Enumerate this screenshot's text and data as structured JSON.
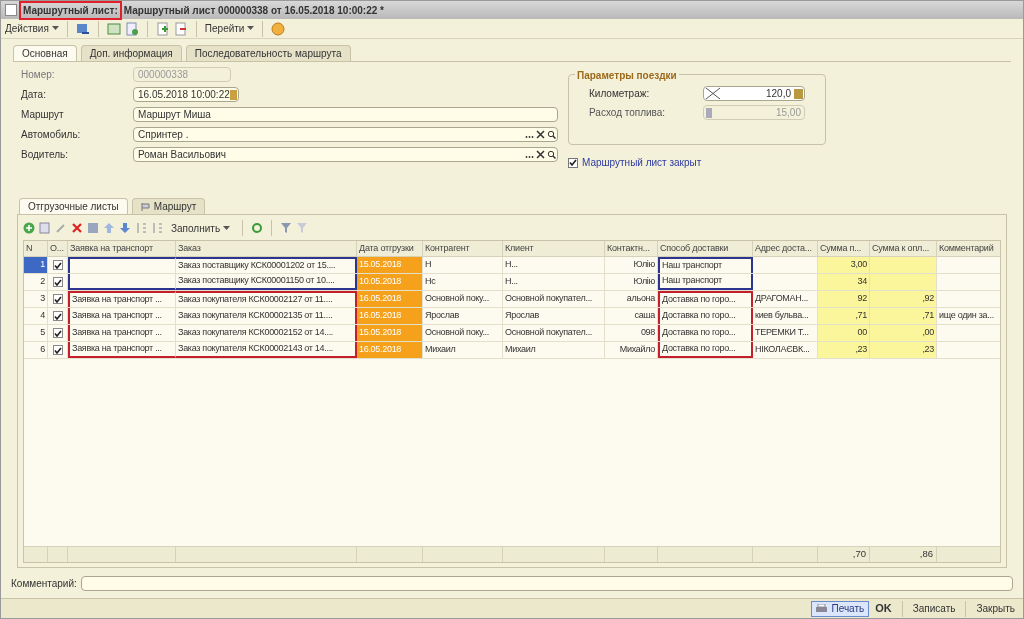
{
  "window": {
    "title_prefix": "Маршрутный лист:",
    "title": "Маршрутный лист 000000338 от 16.05.2018 10:00:22 *"
  },
  "toolbar": {
    "actions": "Действия",
    "goto": "Перейти"
  },
  "tabs": [
    {
      "label": "Основная",
      "selected": true
    },
    {
      "label": "Доп. информация",
      "selected": false
    },
    {
      "label": "Последовательность маршрута",
      "selected": false
    }
  ],
  "fields": [
    {
      "label": "Номер:",
      "value": "000000338",
      "kind": "readonly"
    },
    {
      "label": "Дата:",
      "value": "16.05.2018 10:00:22",
      "kind": "date"
    },
    {
      "label": "Маршрут",
      "value": "Маршрут Миша",
      "kind": "plain"
    },
    {
      "label": "Автомобиль:",
      "value": "Спринтер .",
      "kind": "select"
    },
    {
      "label": "Водитель:",
      "value": "Роман Васильович",
      "kind": "select"
    }
  ],
  "trip": {
    "title": "Параметры поездки",
    "mileage_label": "Километраж:",
    "mileage": "120,0",
    "fuel_label": "Расход топлива:",
    "fuel": "15,00"
  },
  "closed": {
    "label": "Маршрутный лист закрыт",
    "checked": true
  },
  "lower_tabs": [
    {
      "label": "Отгрузочные листы",
      "selected": true
    },
    {
      "label": "Маршрут",
      "selected": false
    }
  ],
  "table_toolbar": {
    "fill": "Заполнить"
  },
  "table": {
    "columns": [
      "N",
      "О...",
      "Заявка на транспорт",
      "Заказ",
      "Дата отгрузки",
      "Контрагент",
      "Клиент",
      "Контактн...",
      "Способ доставки",
      "Адрес доста...",
      "Сумма п...",
      "Сумма к опл...",
      "Комментарий"
    ],
    "rows": [
      {
        "selected": true,
        "checked": true,
        "color": "#2b3590",
        "cells": [
          "1",
          null,
          null,
          "Заказ поставщику КСК00001202 от 15....",
          "15.05.2018",
          "Н",
          "Н...",
          "Юлію",
          "Наш транспорт",
          null,
          "3,00",
          null,
          null
        ]
      },
      {
        "selected": false,
        "checked": true,
        "color": "#2b3590",
        "cells": [
          "2",
          null,
          null,
          "Заказ поставщику КСК00001150 от 10....",
          "10.05.2018",
          "Нс",
          "Н...",
          "Юлію",
          "Наш транспорт",
          null,
          "34",
          null,
          null
        ]
      },
      {
        "selected": false,
        "checked": true,
        "color": "#c4202c",
        "cells": [
          "3",
          null,
          "Заявка на транспорт ...",
          "Заказ покупателя КСК00002127 от 11....",
          "16.05.2018",
          "Основной поку...",
          "Основной покупател...",
          "альона",
          "Доставка по горо...",
          "ДРАГОМАН...",
          "92",
          ",92",
          null
        ]
      },
      {
        "selected": false,
        "checked": true,
        "color": "#c4202c",
        "cells": [
          "4",
          null,
          "Заявка на транспорт ...",
          "Заказ покупателя КСК00002135 от 11....",
          "16.05.2018",
          "Ярослав",
          "Ярослав",
          "саша",
          "Доставка по горо...",
          "киев бульва...",
          ",71",
          ",71",
          "ище один за..."
        ]
      },
      {
        "selected": false,
        "checked": true,
        "color": "#c4202c",
        "cells": [
          "5",
          null,
          "Заявка на транспорт ...",
          "Заказ покупателя КСК00002152 от 14....",
          "15.05.2018",
          "Основной поку...",
          "Основной покупател...",
          "098",
          "Доставка по горо...",
          "ТЕРЕМКИ Т...",
          "00",
          ",00",
          null
        ]
      },
      {
        "selected": false,
        "checked": true,
        "color": "#c4202c",
        "cells": [
          "6",
          null,
          "Заявка на транспорт ...",
          "Заказ покупателя КСК00002143 от 14....",
          "16.05.2018",
          "Михаил",
          "Михаил",
          "Михайло",
          "Доставка по горо...",
          "НІКОЛАЄВК...",
          ",23",
          ",23",
          null
        ]
      }
    ],
    "totals": [
      ",70",
      ",86"
    ]
  },
  "comment_label": "Комментарий:",
  "footer": {
    "print": "Печать",
    "ok": "OK",
    "save": "Записать",
    "close": "Закрыть"
  }
}
